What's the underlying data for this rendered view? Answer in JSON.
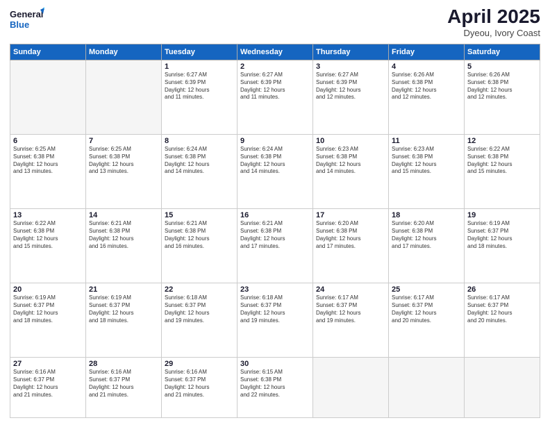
{
  "header": {
    "logo_line1": "General",
    "logo_line2": "Blue",
    "title": "April 2025",
    "subtitle": "Dyeou, Ivory Coast"
  },
  "weekdays": [
    "Sunday",
    "Monday",
    "Tuesday",
    "Wednesday",
    "Thursday",
    "Friday",
    "Saturday"
  ],
  "weeks": [
    [
      {
        "day": "",
        "info": ""
      },
      {
        "day": "",
        "info": ""
      },
      {
        "day": "1",
        "info": "Sunrise: 6:27 AM\nSunset: 6:39 PM\nDaylight: 12 hours\nand 11 minutes."
      },
      {
        "day": "2",
        "info": "Sunrise: 6:27 AM\nSunset: 6:39 PM\nDaylight: 12 hours\nand 11 minutes."
      },
      {
        "day": "3",
        "info": "Sunrise: 6:27 AM\nSunset: 6:39 PM\nDaylight: 12 hours\nand 12 minutes."
      },
      {
        "day": "4",
        "info": "Sunrise: 6:26 AM\nSunset: 6:38 PM\nDaylight: 12 hours\nand 12 minutes."
      },
      {
        "day": "5",
        "info": "Sunrise: 6:26 AM\nSunset: 6:38 PM\nDaylight: 12 hours\nand 12 minutes."
      }
    ],
    [
      {
        "day": "6",
        "info": "Sunrise: 6:25 AM\nSunset: 6:38 PM\nDaylight: 12 hours\nand 13 minutes."
      },
      {
        "day": "7",
        "info": "Sunrise: 6:25 AM\nSunset: 6:38 PM\nDaylight: 12 hours\nand 13 minutes."
      },
      {
        "day": "8",
        "info": "Sunrise: 6:24 AM\nSunset: 6:38 PM\nDaylight: 12 hours\nand 14 minutes."
      },
      {
        "day": "9",
        "info": "Sunrise: 6:24 AM\nSunset: 6:38 PM\nDaylight: 12 hours\nand 14 minutes."
      },
      {
        "day": "10",
        "info": "Sunrise: 6:23 AM\nSunset: 6:38 PM\nDaylight: 12 hours\nand 14 minutes."
      },
      {
        "day": "11",
        "info": "Sunrise: 6:23 AM\nSunset: 6:38 PM\nDaylight: 12 hours\nand 15 minutes."
      },
      {
        "day": "12",
        "info": "Sunrise: 6:22 AM\nSunset: 6:38 PM\nDaylight: 12 hours\nand 15 minutes."
      }
    ],
    [
      {
        "day": "13",
        "info": "Sunrise: 6:22 AM\nSunset: 6:38 PM\nDaylight: 12 hours\nand 15 minutes."
      },
      {
        "day": "14",
        "info": "Sunrise: 6:21 AM\nSunset: 6:38 PM\nDaylight: 12 hours\nand 16 minutes."
      },
      {
        "day": "15",
        "info": "Sunrise: 6:21 AM\nSunset: 6:38 PM\nDaylight: 12 hours\nand 16 minutes."
      },
      {
        "day": "16",
        "info": "Sunrise: 6:21 AM\nSunset: 6:38 PM\nDaylight: 12 hours\nand 17 minutes."
      },
      {
        "day": "17",
        "info": "Sunrise: 6:20 AM\nSunset: 6:38 PM\nDaylight: 12 hours\nand 17 minutes."
      },
      {
        "day": "18",
        "info": "Sunrise: 6:20 AM\nSunset: 6:38 PM\nDaylight: 12 hours\nand 17 minutes."
      },
      {
        "day": "19",
        "info": "Sunrise: 6:19 AM\nSunset: 6:37 PM\nDaylight: 12 hours\nand 18 minutes."
      }
    ],
    [
      {
        "day": "20",
        "info": "Sunrise: 6:19 AM\nSunset: 6:37 PM\nDaylight: 12 hours\nand 18 minutes."
      },
      {
        "day": "21",
        "info": "Sunrise: 6:19 AM\nSunset: 6:37 PM\nDaylight: 12 hours\nand 18 minutes."
      },
      {
        "day": "22",
        "info": "Sunrise: 6:18 AM\nSunset: 6:37 PM\nDaylight: 12 hours\nand 19 minutes."
      },
      {
        "day": "23",
        "info": "Sunrise: 6:18 AM\nSunset: 6:37 PM\nDaylight: 12 hours\nand 19 minutes."
      },
      {
        "day": "24",
        "info": "Sunrise: 6:17 AM\nSunset: 6:37 PM\nDaylight: 12 hours\nand 19 minutes."
      },
      {
        "day": "25",
        "info": "Sunrise: 6:17 AM\nSunset: 6:37 PM\nDaylight: 12 hours\nand 20 minutes."
      },
      {
        "day": "26",
        "info": "Sunrise: 6:17 AM\nSunset: 6:37 PM\nDaylight: 12 hours\nand 20 minutes."
      }
    ],
    [
      {
        "day": "27",
        "info": "Sunrise: 6:16 AM\nSunset: 6:37 PM\nDaylight: 12 hours\nand 21 minutes."
      },
      {
        "day": "28",
        "info": "Sunrise: 6:16 AM\nSunset: 6:37 PM\nDaylight: 12 hours\nand 21 minutes."
      },
      {
        "day": "29",
        "info": "Sunrise: 6:16 AM\nSunset: 6:37 PM\nDaylight: 12 hours\nand 21 minutes."
      },
      {
        "day": "30",
        "info": "Sunrise: 6:15 AM\nSunset: 6:38 PM\nDaylight: 12 hours\nand 22 minutes."
      },
      {
        "day": "",
        "info": ""
      },
      {
        "day": "",
        "info": ""
      },
      {
        "day": "",
        "info": ""
      }
    ]
  ]
}
